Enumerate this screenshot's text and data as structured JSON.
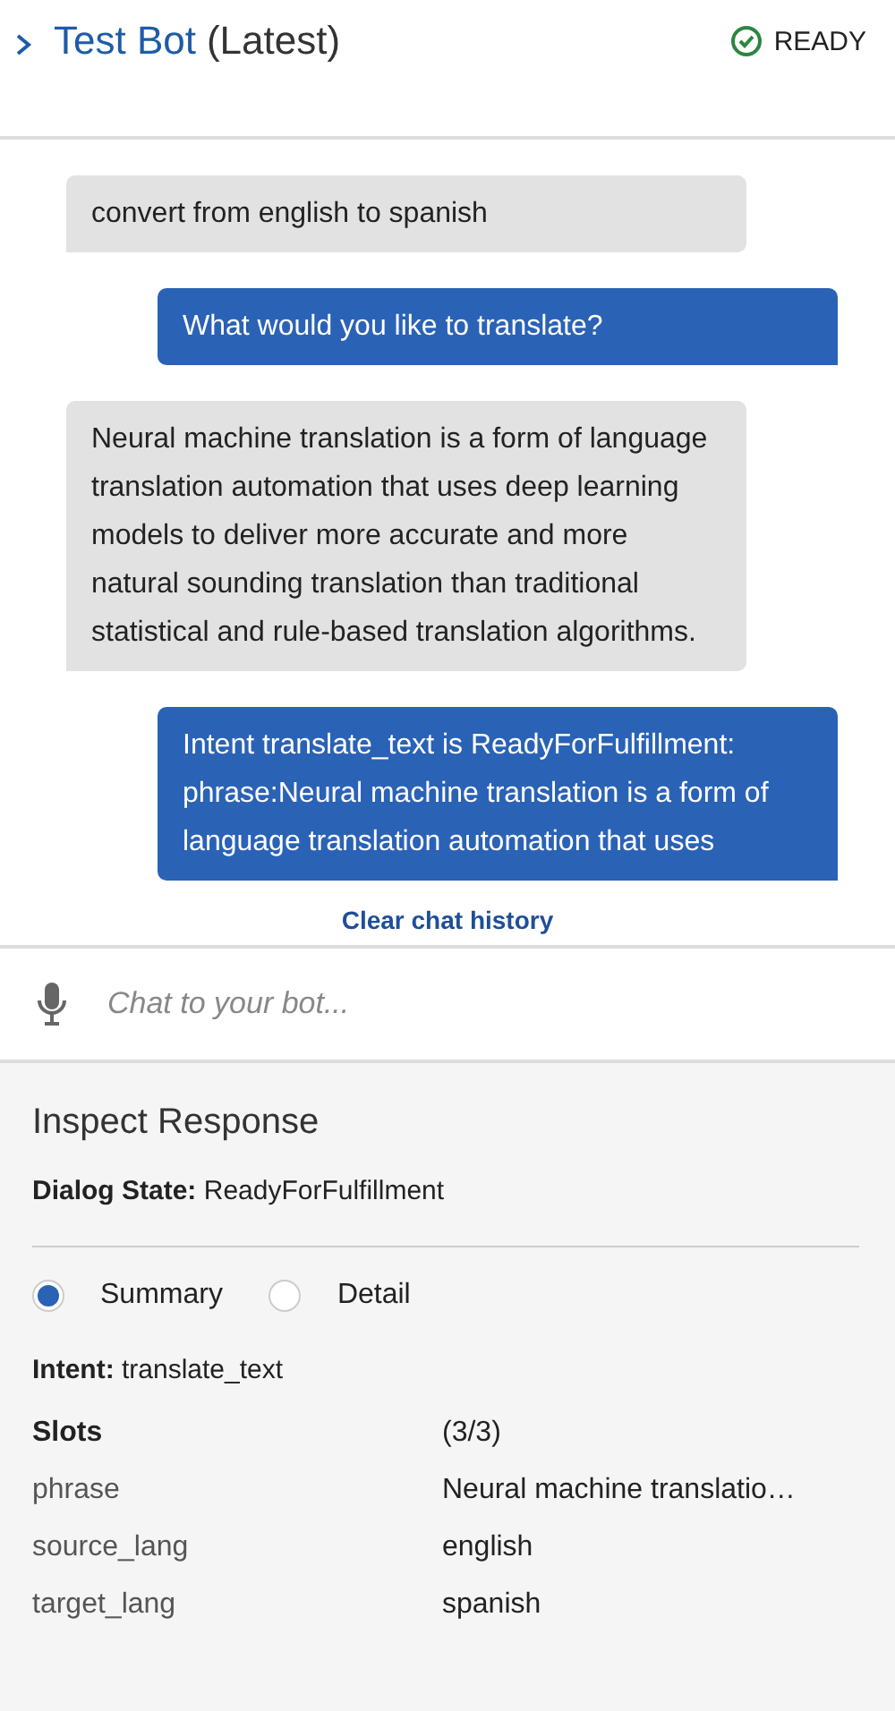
{
  "header": {
    "title": "Test Bot",
    "version": "(Latest)",
    "status": "READY"
  },
  "messages": [
    {
      "kind": "user",
      "text": "convert from english to spanish"
    },
    {
      "kind": "bot",
      "text": "What would you like to translate?"
    },
    {
      "kind": "user",
      "text": "Neural machine translation is a form of language translation automation that uses deep learning models to deliver more accurate and more natural sounding translation than traditional statistical and rule-based translation algorithms."
    },
    {
      "kind": "bot",
      "text": "Intent translate_text is ReadyForFulfillment: phrase:Neural machine translation is a form of language translation automation that uses"
    }
  ],
  "clear_link": "Clear chat history",
  "chat_input": {
    "placeholder": "Chat to your bot..."
  },
  "inspect": {
    "title": "Inspect Response",
    "dialog_state": "**Dialog State:** ReadyForFulfillment",
    "views": [
      {
        "label": "Summary",
        "selected": true
      },
      {
        "label": "Detail",
        "selected": false
      }
    ],
    "intent": "**Intent:** translate_text",
    "slots_label": "Slots",
    "slots_count": "(3/3)",
    "slots": [
      {
        "name": "phrase",
        "value": "Neural machine translatio…"
      },
      {
        "name": "source_lang",
        "value": "english"
      },
      {
        "name": "target_lang",
        "value": "spanish"
      }
    ]
  }
}
